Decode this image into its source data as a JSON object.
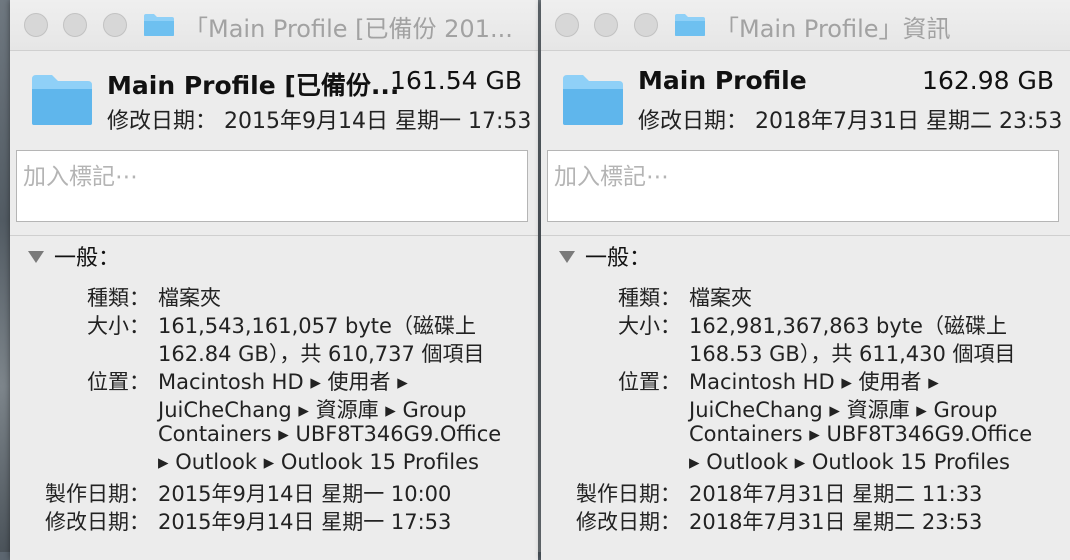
{
  "windows": [
    {
      "title": "「Main Profile [已備份 201...",
      "name": "Main Profile [已備份...",
      "size": "161.54 GB",
      "modified_header": "修改日期： 2015年9月14日 星期一 17:53",
      "tags_placeholder": "加入標記⋯",
      "section": "一般：",
      "info": [
        {
          "label": "種類：",
          "value": "檔案夾"
        },
        {
          "label": "大小：",
          "value": "161,543,161,057 byte（磁碟上"
        },
        {
          "label": "",
          "value": "162.84 GB），共 610,737 個項目"
        },
        {
          "label": "位置：",
          "value": "Macintosh HD ▸ 使用者 ▸"
        },
        {
          "label": "",
          "value": "JuiCheChang ▸ 資源庫 ▸ Group"
        },
        {
          "label": "",
          "value": "Containers ▸ UBF8T346G9.Office"
        },
        {
          "label": "",
          "value": "▸ Outlook ▸ Outlook 15 Profiles"
        },
        {
          "label": "製作日期：",
          "value": "2015年9月14日 星期一 10:00"
        },
        {
          "label": "修改日期：",
          "value": "2015年9月14日 星期一 17:53"
        }
      ]
    },
    {
      "title": "「Main Profile」資訊",
      "name": "Main Profile",
      "size": "162.98 GB",
      "modified_header": "修改日期： 2018年7月31日 星期二 23:53",
      "tags_placeholder": "加入標記⋯",
      "section": "一般：",
      "info": [
        {
          "label": "種類：",
          "value": "檔案夾"
        },
        {
          "label": "大小：",
          "value": "162,981,367,863 byte（磁碟上"
        },
        {
          "label": "",
          "value": "168.53 GB），共 611,430 個項目"
        },
        {
          "label": "位置：",
          "value": "Macintosh HD ▸ 使用者 ▸"
        },
        {
          "label": "",
          "value": "JuiCheChang ▸ 資源庫 ▸ Group"
        },
        {
          "label": "",
          "value": "Containers ▸ UBF8T346G9.Office"
        },
        {
          "label": "",
          "value": "▸ Outlook ▸ Outlook 15 Profiles"
        },
        {
          "label": "製作日期：",
          "value": "2018年7月31日 星期二 11:33"
        },
        {
          "label": "修改日期：",
          "value": "2018年7月31日 星期二 23:53"
        }
      ]
    }
  ],
  "colors": {
    "folder": "#5fb6ec",
    "folder_light": "#8fd0f7",
    "traffic_light_inactive": "#d7d7d7"
  }
}
